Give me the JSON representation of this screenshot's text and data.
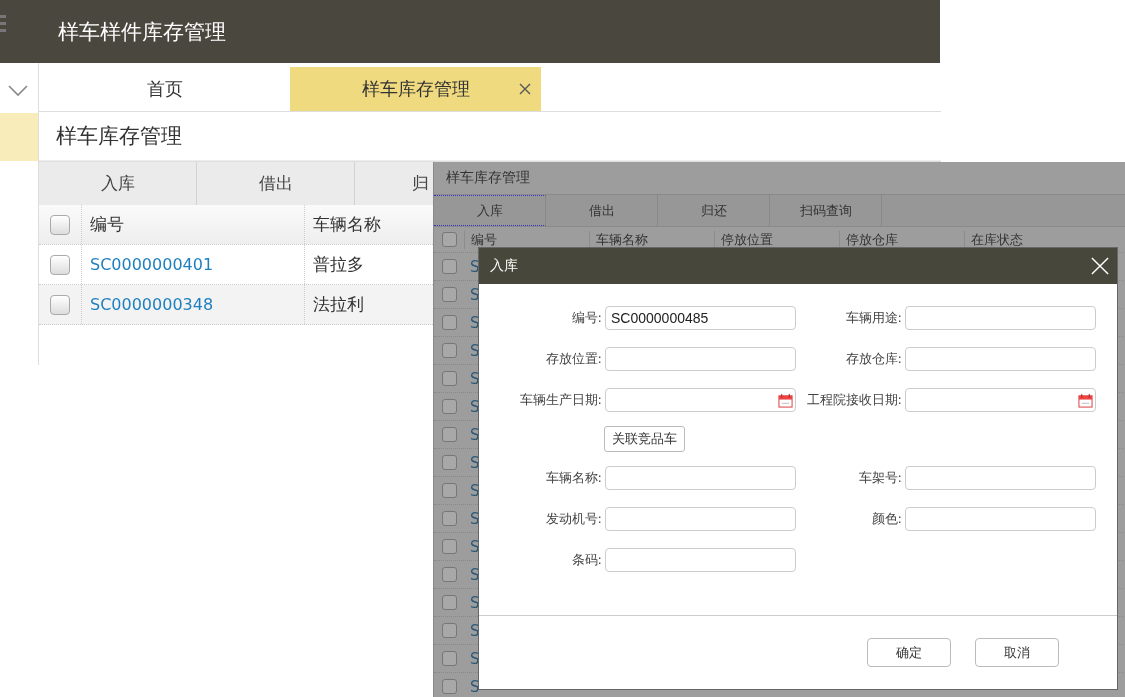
{
  "app": {
    "title": "样车样件库存管理"
  },
  "tabs": [
    {
      "label": "首页",
      "selected": false,
      "closable": false
    },
    {
      "label": "样车库存管理",
      "selected": true,
      "closable": true
    }
  ],
  "page": {
    "title": "样车库存管理",
    "toolbar": [
      "入库",
      "借出",
      "归"
    ],
    "table": {
      "all_checked": false,
      "columns": [
        "编号",
        "车辆名称"
      ],
      "rows": [
        {
          "checked": false,
          "cells": [
            "SC0000000401",
            "普拉多"
          ]
        },
        {
          "checked": false,
          "cells": [
            "SC0000000348",
            "法拉利"
          ]
        }
      ]
    }
  },
  "inset": {
    "title": "样车库存管理",
    "toolbar": [
      {
        "label": "入库",
        "selected": true
      },
      {
        "label": "借出",
        "selected": false
      },
      {
        "label": "归还",
        "selected": false
      },
      {
        "label": "扫码查询",
        "selected": false
      }
    ],
    "all_checked": false,
    "columns": [
      "编号",
      "车辆名称",
      "停放位置",
      "停放仓库",
      "在库状态"
    ],
    "rows": [
      {
        "checked": false,
        "code": "S"
      },
      {
        "checked": false,
        "code": "S"
      },
      {
        "checked": false,
        "code": "S"
      },
      {
        "checked": false,
        "code": "S"
      },
      {
        "checked": false,
        "code": "S"
      },
      {
        "checked": false,
        "code": "S"
      },
      {
        "checked": false,
        "code": "S"
      },
      {
        "checked": false,
        "code": "S"
      },
      {
        "checked": false,
        "code": "S"
      },
      {
        "checked": false,
        "code": "S"
      },
      {
        "checked": false,
        "code": "S"
      },
      {
        "checked": false,
        "code": "S"
      },
      {
        "checked": false,
        "code": "S"
      },
      {
        "checked": false,
        "code": "S"
      },
      {
        "checked": false,
        "code": "S"
      },
      {
        "checked": false,
        "code": "S"
      }
    ]
  },
  "dialog": {
    "title": "入库",
    "fields_top": [
      {
        "label": "编号:",
        "value": "SC0000000485",
        "kind": "text"
      },
      {
        "label": "车辆用途:",
        "kind": "text"
      },
      {
        "label": "存放位置:",
        "kind": "text"
      },
      {
        "label": "存放仓库:",
        "kind": "text"
      },
      {
        "label": "车辆生产日期:",
        "kind": "date"
      },
      {
        "label": "工程院接收日期:",
        "kind": "date"
      }
    ],
    "link_button": "关联竞品车",
    "fields_bottom": [
      {
        "label": "车辆名称:",
        "kind": "text"
      },
      {
        "label": "车架号:",
        "kind": "text"
      },
      {
        "label": "发动机号:",
        "kind": "text"
      },
      {
        "label": "颜色:",
        "kind": "text"
      },
      {
        "label": "条码:",
        "kind": "text"
      }
    ],
    "buttons": [
      "确定",
      "取消"
    ]
  }
}
